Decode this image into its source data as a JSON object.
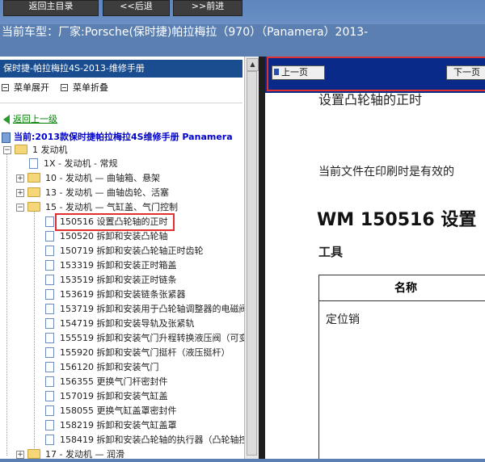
{
  "toolbar": {
    "home_label": "返回主目录",
    "back_label": "<<后退",
    "forward_label": ">>前进"
  },
  "car_line": "当前车型：厂家:Porsche(保时捷)帕拉梅拉（970）（Panamera）2013-",
  "left_panel": {
    "title": "保时捷-帕拉梅拉4S-2013-维修手册",
    "expand_label": "菜单展开",
    "collapse_label": "菜单折叠",
    "back_link": "返回上一级",
    "current_label": "当前:2013款保时捷帕拉梅拉4S维修手册 Panamera"
  },
  "tree": {
    "root": {
      "label": "1 发动机",
      "toggle": "−"
    },
    "items": [
      {
        "label": "1X - 发动机 - 常规",
        "type": "doc"
      },
      {
        "label": "10 - 发动机 — 曲轴箱、悬架",
        "type": "folder",
        "toggle": "+"
      },
      {
        "label": "13 - 发动机 — 曲轴齿轮、活塞",
        "type": "folder",
        "toggle": "+"
      },
      {
        "label": "15 - 发动机 — 气缸盖、气门控制",
        "type": "folder",
        "toggle": "−"
      }
    ],
    "sub_items": [
      "150516 设置凸轮轴的正时",
      "150520 拆卸和安装凸轮轴",
      "150719 拆卸和安装凸轮轴正时齿轮",
      "153319 拆卸和安装正时箱盖",
      "153519 拆卸和安装正时链条",
      "153619 拆卸和安装链条张紧器",
      "153719 拆卸和安装用于凸轮轴调整器的电磁阀",
      "154719 拆卸和安装导轨及张紧轨",
      "155519 拆卸和安装气门升程转换液压阀（可变",
      "155920 拆卸和安装气门挺杆（液压挺杆）",
      "156120 拆卸和安装气门",
      "156355 更换气门杆密封件",
      "157019 拆卸和安装气缸盖",
      "158055 更换气缸盖罩密封件",
      "158219 拆卸和安装气缸盖罩",
      "158419 拆卸和安装凸轮轴的执行器（凸轮轴控"
    ],
    "last_item": {
      "label": "17 - 发动机 — 润滑",
      "toggle": "+"
    }
  },
  "right_panel": {
    "prev_label": "上一页",
    "next_label": "下一页",
    "heading_small": "设置凸轮轴的正时",
    "notice": "当前文件在印刷时是有效的",
    "main_heading": "WM 150516 设置",
    "section_label": "工具",
    "table_header": "名称",
    "table_cell": "定位销"
  }
}
